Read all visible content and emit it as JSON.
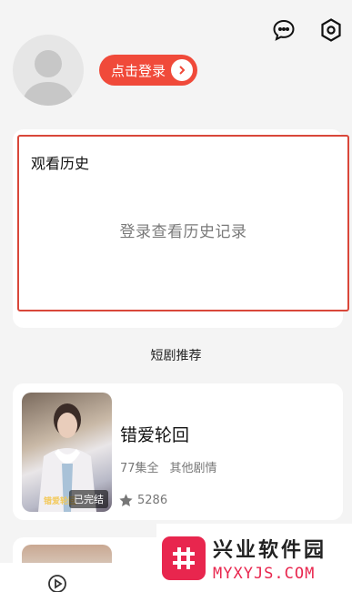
{
  "header": {
    "chat_icon": "chat-bubble-icon",
    "settings_icon": "gear-icon",
    "login_label": "点击登录"
  },
  "history": {
    "title": "观看历史",
    "empty_text": "登录查看历史记录"
  },
  "recommend": {
    "section_title": "短剧推荐",
    "items": [
      {
        "title": "错爱轮回",
        "episodes": "77集全",
        "category": "其他剧情",
        "score": "5286",
        "status_tag": "已完结",
        "poster_brand": "错爱轮回"
      }
    ]
  },
  "watermark": {
    "cn": "兴业软件园",
    "en": "MYXYJS.COM"
  },
  "colors": {
    "accent": "#f04a3a",
    "highlight_border": "#d9473a",
    "background": "#f4f4f4",
    "watermark_brand": "#e8264e"
  }
}
